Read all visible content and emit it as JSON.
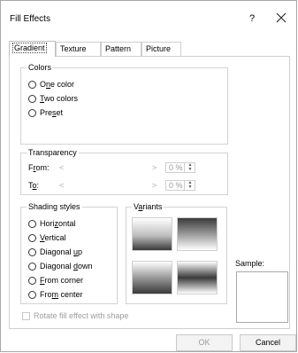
{
  "dialog": {
    "title": "Fill Effects",
    "help_label": "?"
  },
  "tabs": [
    {
      "label": "Gradient",
      "active": true
    },
    {
      "label": "Texture"
    },
    {
      "label": "Pattern"
    },
    {
      "label": "Picture"
    }
  ],
  "colors": {
    "title": "Colors",
    "options": [
      {
        "pre": "O",
        "key": "n",
        "post": "e color"
      },
      {
        "pre": "",
        "key": "T",
        "post": "wo colors"
      },
      {
        "pre": "Pre",
        "key": "s",
        "post": "et"
      }
    ]
  },
  "transparency": {
    "title": "Transparency",
    "from": {
      "pre": "F",
      "key": "r",
      "post": "om:",
      "value": "0 %"
    },
    "to": {
      "pre": "T",
      "key": "o",
      "post": ":",
      "value": "0 %"
    },
    "left_arrow": "<",
    "right_arrow": ">"
  },
  "shading": {
    "title": "Shading styles",
    "options": [
      {
        "pre": "Hori",
        "key": "z",
        "post": "ontal"
      },
      {
        "pre": "",
        "key": "V",
        "post": "ertical"
      },
      {
        "pre": "Diagonal ",
        "key": "u",
        "post": "p"
      },
      {
        "pre": "Diagonal ",
        "key": "d",
        "post": "own"
      },
      {
        "pre": "",
        "key": "F",
        "post": "rom corner"
      },
      {
        "pre": "Fro",
        "key": "m",
        "post": " center"
      }
    ]
  },
  "variants": {
    "pre": "V",
    "key": "a",
    "post": "riants"
  },
  "sample_label": "Sample:",
  "rotate_checkbox_label": "Rotate fill effect with shape",
  "buttons": {
    "ok": "OK",
    "cancel": "Cancel"
  },
  "colors_palette": {
    "border": "#cfcfcf",
    "disabled_text": "#9c9c9c"
  }
}
